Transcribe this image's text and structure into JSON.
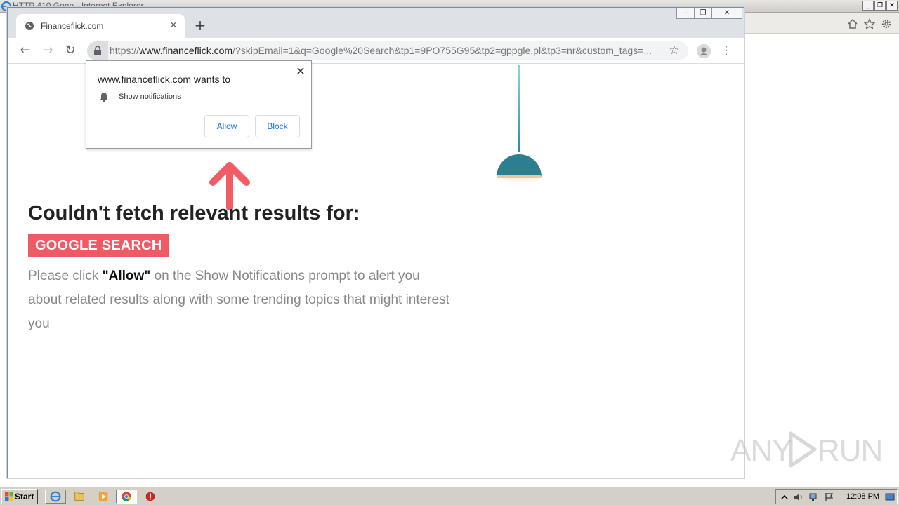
{
  "ie": {
    "title": "HTTP 410 Gone - Internet Explorer",
    "minimize": "_",
    "restore": "❐",
    "close": "✕"
  },
  "chrome": {
    "tab_title": "Financeflick.com",
    "tab_close": "✕",
    "new_tab": "+",
    "url_scheme": "https://",
    "url_host": "www.financeflick.com",
    "url_rest": "/?skipEmail=1&q=Google%20Search&tp1=9PO755G95&tp2=gppgle.pl&tp3=nr&custom_tags=...",
    "back": "←",
    "forward": "→",
    "reload": "↻",
    "star": "☆",
    "menu": "⋮",
    "win_minimize": "—",
    "win_restore": "❐",
    "win_close": "✕"
  },
  "notification": {
    "title": "www.financeflick.com wants to",
    "permission": "Show notifications",
    "allow": "Allow",
    "block": "Block",
    "close": "✕"
  },
  "page": {
    "headline": "Couldn't fetch relevant results for:",
    "query": "GOOGLE SEARCH",
    "message_pre": "Please click ",
    "message_bold": "\"Allow\"",
    "message_post": " on the Show Notifications prompt to alert you about related results along with some trending topics that might interest you"
  },
  "watermark": {
    "left": "ANY",
    "right": "RUN"
  },
  "taskbar": {
    "start": "Start",
    "clock": "12:08 PM"
  },
  "colors": {
    "badge": "#f05a64",
    "arrow": "#f25c66",
    "lamp": "#2b7f8e"
  }
}
